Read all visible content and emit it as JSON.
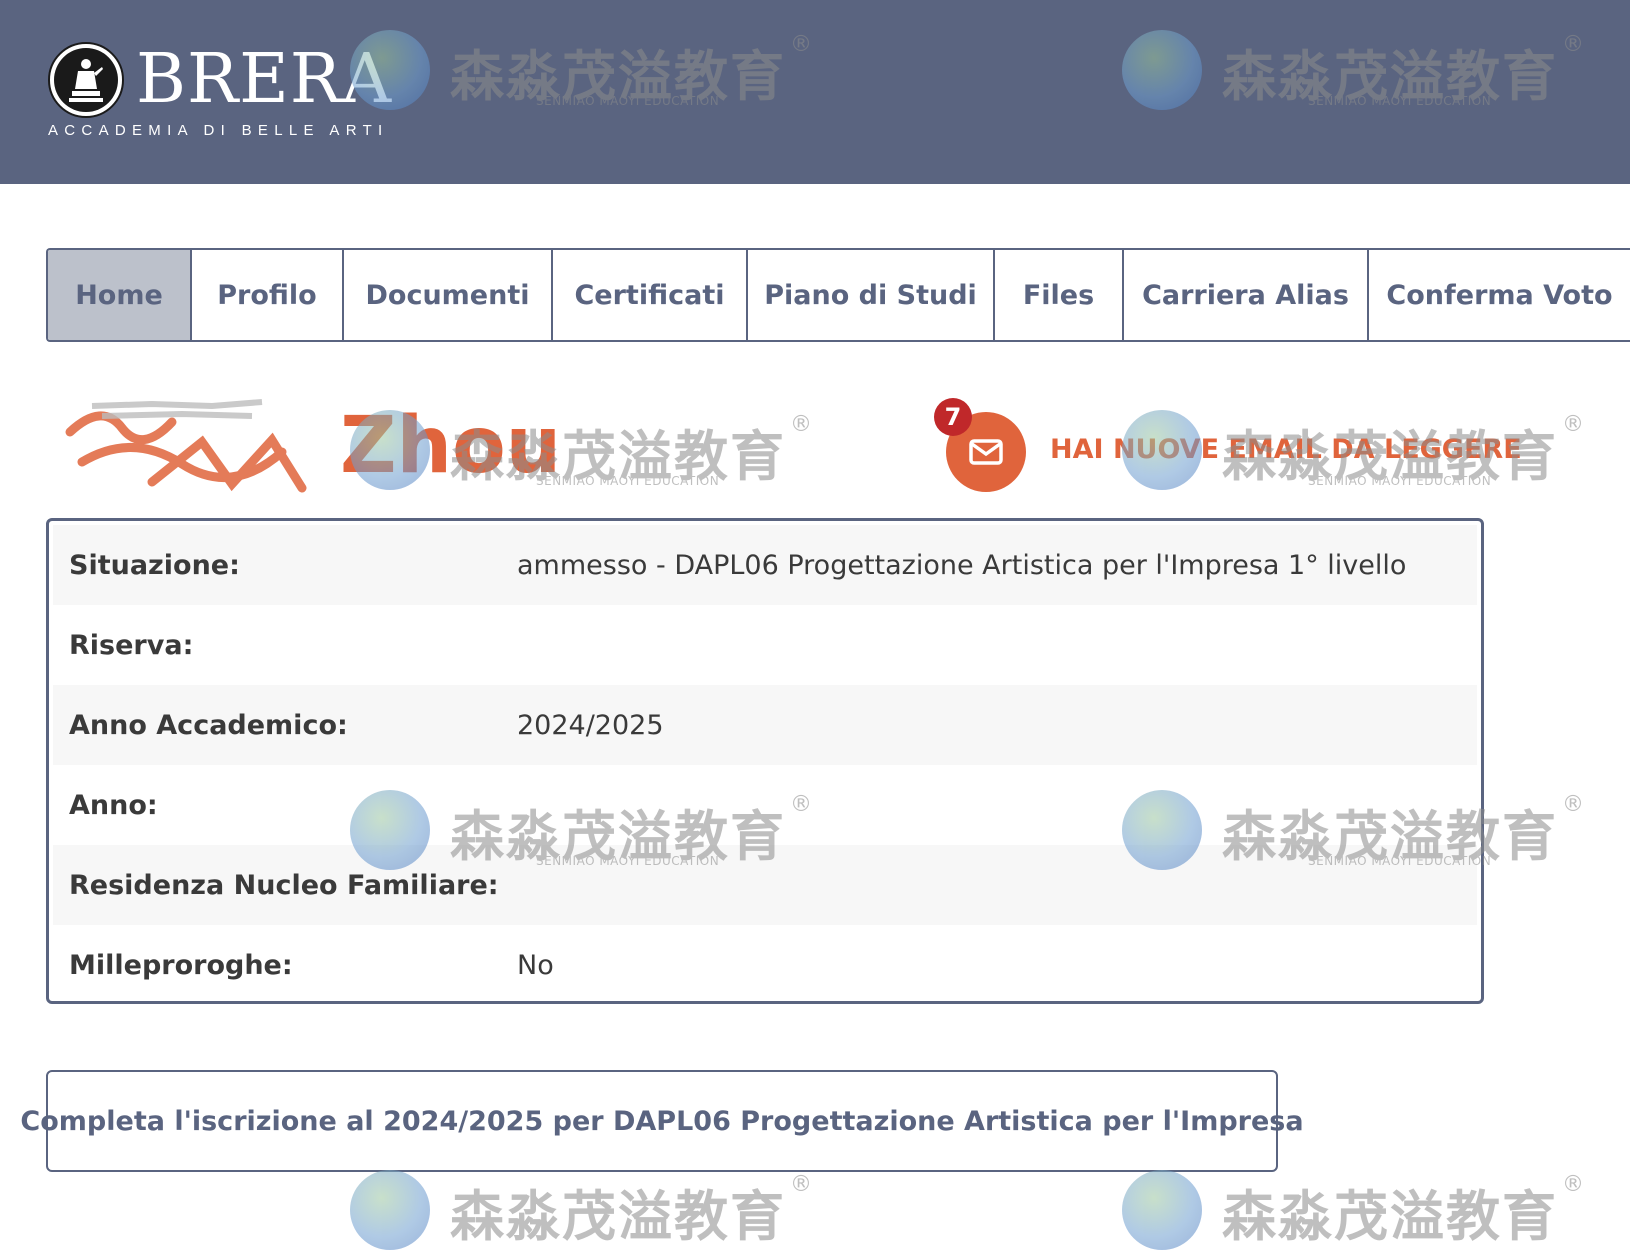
{
  "header": {
    "logo_name": "BRERA",
    "logo_subtitle": "ACCADEMIA DI BELLE ARTI",
    "background": "#5a6480"
  },
  "tabs": [
    {
      "label": "Home",
      "active": true
    },
    {
      "label": "Profilo",
      "active": false
    },
    {
      "label": "Documenti",
      "active": false
    },
    {
      "label": "Certificati",
      "active": false
    },
    {
      "label": "Piano di Studi",
      "active": false
    },
    {
      "label": "Files",
      "active": false
    },
    {
      "label": "Carriera Alias",
      "active": false
    },
    {
      "label": "Conferma Voto",
      "active": false
    }
  ],
  "user": {
    "name": "Zhou"
  },
  "mail": {
    "count": "7",
    "message": "HAI NUOVE EMAIL DA LEGGERE",
    "icon": "envelope-icon",
    "accent": "#e0643c",
    "badge_color": "#c0282a"
  },
  "info": {
    "rows": [
      {
        "label": "Situazione:",
        "value": "ammesso - DAPL06 Progettazione Artistica per l'Impresa 1° livello"
      },
      {
        "label": "Riserva:",
        "value": ""
      },
      {
        "label": "Anno Accademico:",
        "value": "2024/2025"
      },
      {
        "label": "Anno:",
        "value": ""
      },
      {
        "label": "Residenza Nucleo Familiare:",
        "value": ""
      },
      {
        "label": "Milleproroghe:",
        "value": "No"
      }
    ]
  },
  "action": {
    "label": "Completa l'iscrizione al 2024/2025 per DAPL06 Progettazione Artistica per l'Impresa"
  },
  "watermark": {
    "text": "森淼茂溢教育",
    "reg": "®",
    "sub": "SENMIAO MAOYI EDUCATION"
  }
}
